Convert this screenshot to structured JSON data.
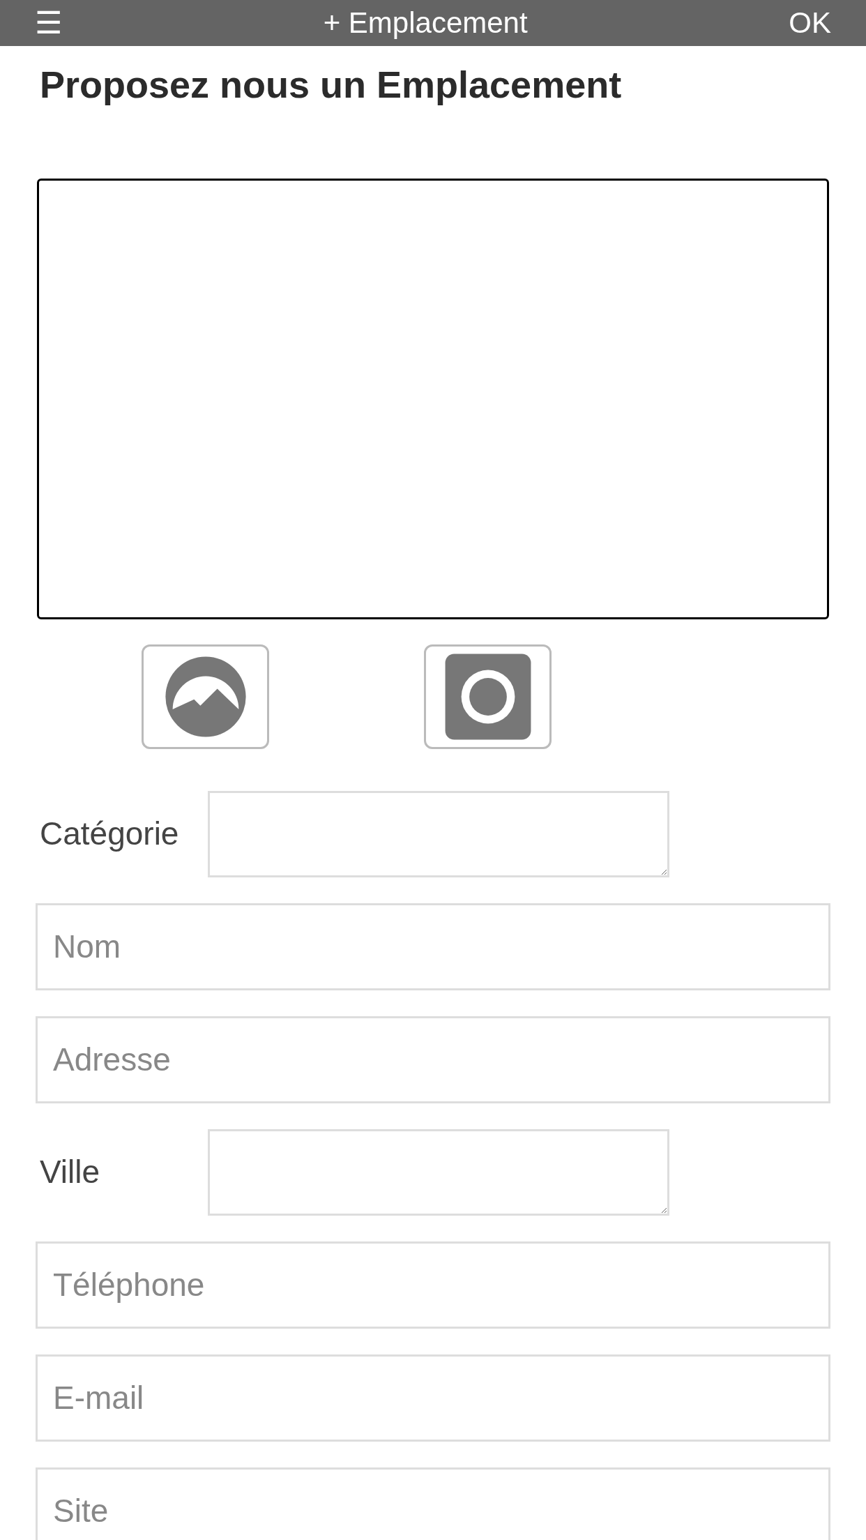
{
  "header": {
    "menu": "☰",
    "title": "+ Emplacement",
    "action": "OK"
  },
  "heading": "Proposez nous un Emplacement",
  "photo_buttons": [
    {
      "kind": "gallery"
    },
    {
      "kind": "camera"
    }
  ],
  "fields": [
    {
      "kind": "labeled",
      "label": "Catégorie"
    },
    {
      "kind": "input",
      "placeholder": "Nom"
    },
    {
      "kind": "input",
      "placeholder": "Adresse"
    },
    {
      "kind": "labeled",
      "label": "Ville"
    },
    {
      "kind": "input",
      "placeholder": "Téléphone"
    },
    {
      "kind": "input",
      "placeholder": "E-mail"
    },
    {
      "kind": "input",
      "placeholder": "Site"
    }
  ]
}
